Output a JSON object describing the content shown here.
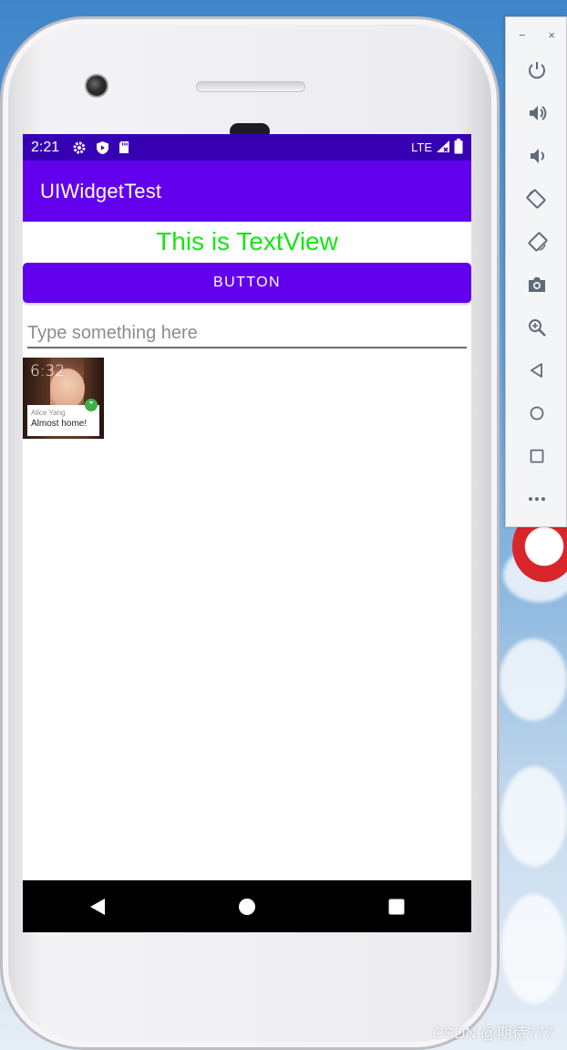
{
  "status_bar": {
    "time": "2:21",
    "network": "LTE"
  },
  "app_bar": {
    "title": "UIWidgetTest"
  },
  "textview": {
    "text": "This is TextView"
  },
  "button": {
    "label": "BUTTON"
  },
  "edit_text": {
    "value": "",
    "placeholder": "Type something here"
  },
  "image": {
    "clock": "6:32",
    "sender": "Alice Yang",
    "message": "Almost home!"
  },
  "emulator_toolbar": {
    "window_controls": {
      "minimize": "−",
      "close": "×"
    },
    "tools": [
      "power-icon",
      "volume-up-icon",
      "volume-down-icon",
      "rotate-left-icon",
      "rotate-right-icon",
      "camera-icon",
      "zoom-icon",
      "back-icon",
      "home-icon",
      "overview-icon",
      "more-icon"
    ]
  },
  "watermark": "CSDN @期待777",
  "colors": {
    "status_bar": "#3700b3",
    "primary": "#6200ee",
    "textview_text": "#14e614",
    "nav_bar": "#000000"
  }
}
